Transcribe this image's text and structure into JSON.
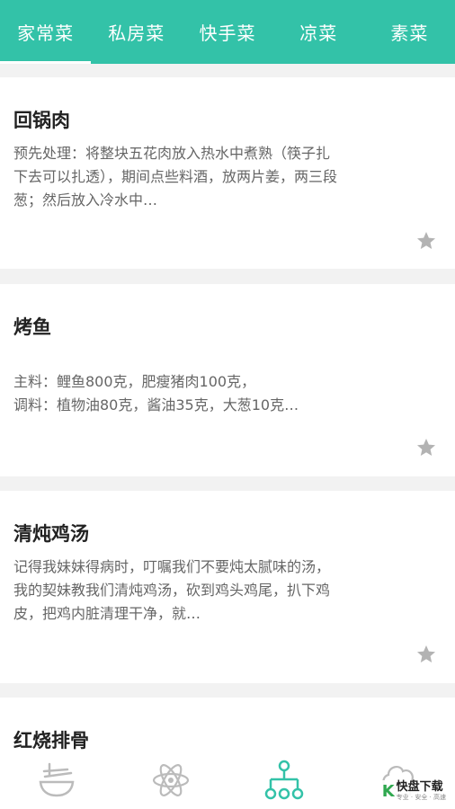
{
  "tabs": [
    "家常菜",
    "私房菜",
    "快手菜",
    "凉菜",
    "素菜"
  ],
  "recipes": [
    {
      "title": "回锅肉",
      "desc": "预先处理：将整块五花肉放入热水中煮熟（筷子扎下去可以扎透），期间点些料酒，放两片姜，两三段葱；然后放入冷水中…"
    },
    {
      "title": "烤鱼",
      "desc": "主料：鲤鱼800克，肥瘦猪肉100克，\n调料：植物油80克，酱油35克，大葱10克…"
    },
    {
      "title": "清炖鸡汤",
      "desc": "记得我妹妹得病时，叮嘱我们不要炖太腻味的汤，我的契妹教我们清炖鸡汤，砍到鸡头鸡尾，扒下鸡皮，把鸡内脏清理干净，就…"
    },
    {
      "title": "红烧排骨",
      "desc": ""
    }
  ],
  "bottom_nav": [
    "bowl-icon",
    "atom-icon",
    "hierarchy-icon",
    "chef-hat-icon"
  ],
  "watermark": {
    "title": "快盘下载",
    "sub": "专业 · 安全 · 高速"
  },
  "colors": {
    "accent": "#33c2a8",
    "star": "#b3b3b3",
    "nav_icon": "#bbbbbb"
  }
}
